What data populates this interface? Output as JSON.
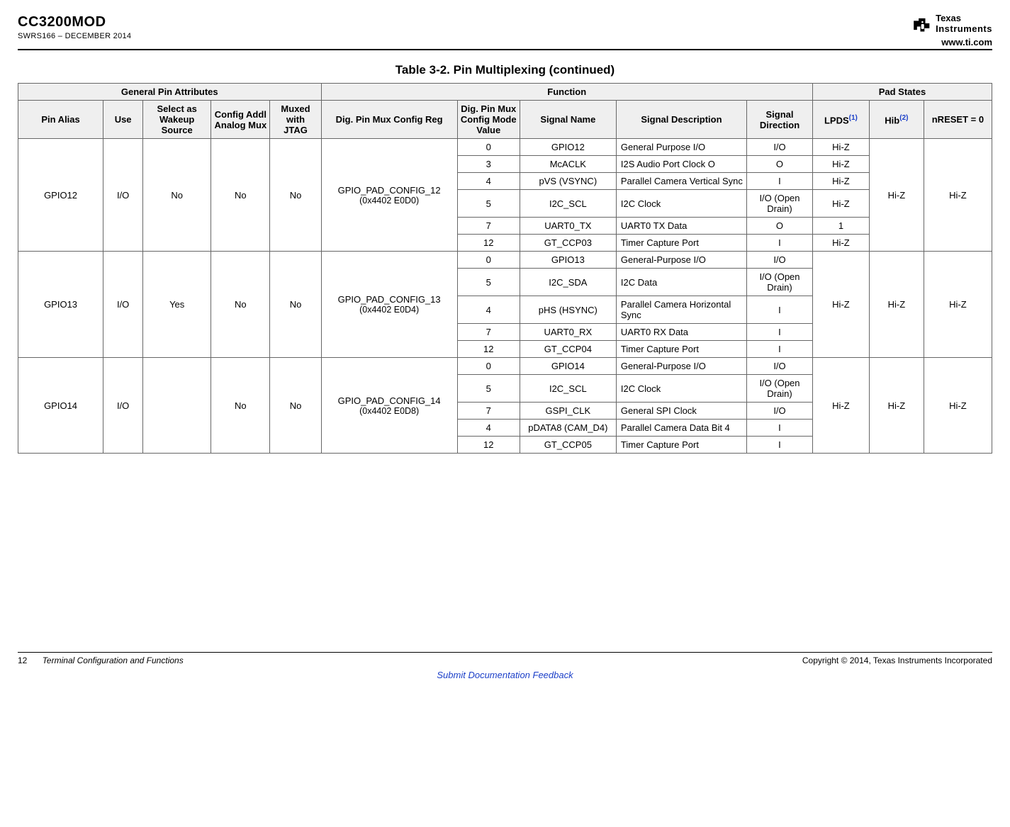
{
  "header": {
    "doc_title": "CC3200MOD",
    "doc_subtitle": "SWRS166 – DECEMBER 2014",
    "brand": "TEXAS INSTRUMENTS",
    "url": "www.ti.com"
  },
  "table": {
    "caption": "Table 3-2. Pin Multiplexing (continued)",
    "group_headers": {
      "general": "General Pin Attributes",
      "function": "Function",
      "pad": "Pad States"
    },
    "col_headers": {
      "pin_alias": "Pin Alias",
      "use": "Use",
      "wakeup": "Select as Wakeup Source",
      "addl_mux": "Config Addl Analog Mux",
      "jtag": "Muxed with JTAG",
      "reg": "Dig. Pin Mux Config Reg",
      "mode": "Dig. Pin Mux Config Mode Value",
      "signal": "Signal Name",
      "desc": "Signal Description",
      "dir": "Signal Direction",
      "lpds": "LPDS",
      "lpds_sup": "(1)",
      "hib": "Hib",
      "hib_sup": "(2)",
      "nreset": "nRESET = 0"
    },
    "pins": [
      {
        "alias": "GPIO12",
        "use": "I/O",
        "wakeup": "No",
        "addl_mux": "No",
        "jtag": "No",
        "reg_name": "GPIO_PAD_CONFIG_12",
        "reg_addr": "(0x4402 E0D0)",
        "hib": "Hi-Z",
        "nreset": "Hi-Z",
        "funcs": [
          {
            "mode": "0",
            "signal": "GPIO12",
            "desc": "General Purpose I/O",
            "dir": "I/O",
            "lpds": "Hi-Z"
          },
          {
            "mode": "3",
            "signal": "McACLK",
            "desc": "I2S Audio Port Clock O",
            "dir": "O",
            "lpds": "Hi-Z"
          },
          {
            "mode": "4",
            "signal": "pVS (VSYNC)",
            "desc": "Parallel Camera Vertical Sync",
            "dir": "I",
            "lpds": "Hi-Z"
          },
          {
            "mode": "5",
            "signal": "I2C_SCL",
            "desc": "I2C Clock",
            "dir": "I/O (Open Drain)",
            "lpds": "Hi-Z"
          },
          {
            "mode": "7",
            "signal": "UART0_TX",
            "desc": "UART0 TX Data",
            "dir": "O",
            "lpds": "1"
          },
          {
            "mode": "12",
            "signal": "GT_CCP03",
            "desc": "Timer Capture Port",
            "dir": "I",
            "lpds": "Hi-Z"
          }
        ]
      },
      {
        "alias": "GPIO13",
        "use": "I/O",
        "wakeup": "Yes",
        "addl_mux": "No",
        "jtag": "No",
        "reg_name": "GPIO_PAD_CONFIG_13",
        "reg_addr": "(0x4402 E0D4)",
        "lpds": "Hi-Z",
        "hib": "Hi-Z",
        "nreset": "Hi-Z",
        "funcs": [
          {
            "mode": "0",
            "signal": "GPIO13",
            "desc": "General-Purpose I/O",
            "dir": "I/O"
          },
          {
            "mode": "5",
            "signal": "I2C_SDA",
            "desc": "I2C Data",
            "dir": "I/O (Open Drain)"
          },
          {
            "mode": "4",
            "signal": "pHS (HSYNC)",
            "desc": "Parallel Camera Horizontal Sync",
            "dir": "I"
          },
          {
            "mode": "7",
            "signal": "UART0_RX",
            "desc": "UART0 RX Data",
            "dir": "I"
          },
          {
            "mode": "12",
            "signal": "GT_CCP04",
            "desc": "Timer Capture Port",
            "dir": "I"
          }
        ]
      },
      {
        "alias": "GPIO14",
        "use": "I/O",
        "wakeup": "",
        "addl_mux": "No",
        "jtag": "No",
        "reg_name": "GPIO_PAD_CONFIG_14",
        "reg_addr": "(0x4402 E0D8)",
        "lpds": "Hi-Z",
        "hib": "Hi-Z",
        "nreset": "Hi-Z",
        "funcs": [
          {
            "mode": "0",
            "signal": "GPIO14",
            "desc": "General-Purpose I/O",
            "dir": "I/O"
          },
          {
            "mode": "5",
            "signal": "I2C_SCL",
            "desc": "I2C Clock",
            "dir": "I/O (Open Drain)"
          },
          {
            "mode": "7",
            "signal": "GSPI_CLK",
            "desc": "General SPI Clock",
            "dir": "I/O"
          },
          {
            "mode": "4",
            "signal": "pDATA8 (CAM_D4)",
            "desc": "Parallel Camera Data Bit 4",
            "dir": "I"
          },
          {
            "mode": "12",
            "signal": "GT_CCP05",
            "desc": "Timer Capture Port",
            "dir": "I"
          }
        ]
      }
    ]
  },
  "footer": {
    "page": "12",
    "section": "Terminal Configuration and Functions",
    "copyright": "Copyright © 2014, Texas Instruments Incorporated",
    "feedback": "Submit Documentation Feedback"
  }
}
